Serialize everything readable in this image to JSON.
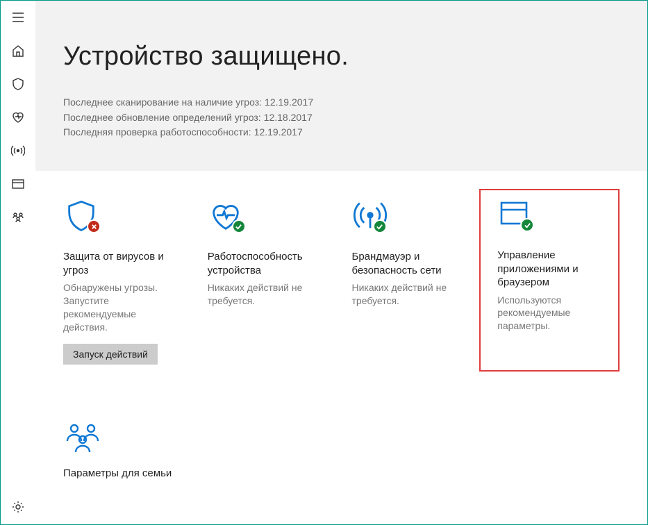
{
  "header": {
    "title": "Устройство защищено.",
    "last_scan_label": "Последнее сканирование на наличие угроз:",
    "last_scan_date": "12.19.2017",
    "last_update_label": "Последнее обновление определений угроз:",
    "last_update_date": "12.18.2017",
    "last_health_label": "Последняя проверка работоспособности:",
    "last_health_date": "12.19.2017"
  },
  "cards": {
    "virus": {
      "title": "Защита от вирусов и угроз",
      "desc": "Обнаружены угрозы. Запустите рекомендуемые действия.",
      "action": "Запуск действий"
    },
    "health": {
      "title": "Работоспособность устройства",
      "desc": "Никаких действий не требуется."
    },
    "firewall": {
      "title": "Брандмауэр и безопасность сети",
      "desc": "Никаких действий не требуется."
    },
    "apps": {
      "title": "Управление приложениями и браузером",
      "desc": "Используются рекомендуемые параметры."
    },
    "family": {
      "title": "Параметры для семьи"
    }
  },
  "colors": {
    "accent": "#1078d4",
    "danger": "#c22b1a",
    "ok": "#15873b"
  }
}
